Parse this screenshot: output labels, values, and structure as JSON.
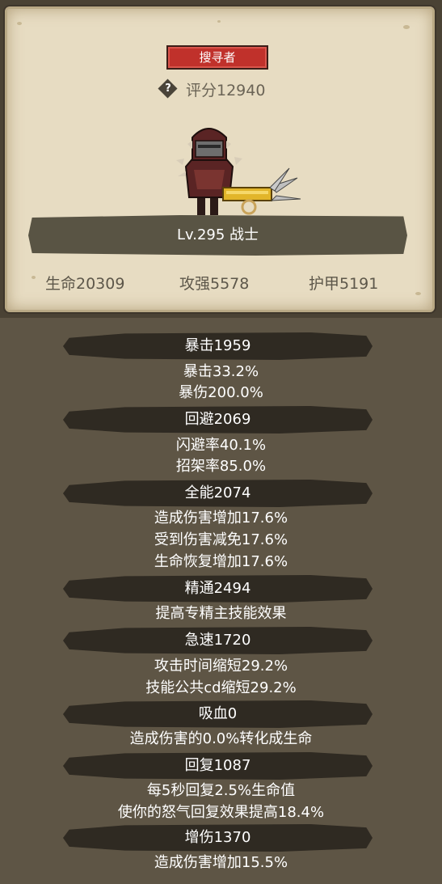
{
  "title_badge": "搜寻者",
  "score": "评分12940",
  "level": "Lv.295 战士",
  "core_stats": {
    "hp": "生命20309",
    "attack": "攻强5578",
    "armor": "护甲5191"
  },
  "stats": {
    "crit": {
      "header": "暴击1959",
      "lines": [
        "暴击33.2%",
        "暴伤200.0%"
      ]
    },
    "dodge": {
      "header": "回避2069",
      "lines": [
        "闪避率40.1%",
        "招架率85.0%"
      ]
    },
    "versatility": {
      "header": "全能2074",
      "lines": [
        "造成伤害增加17.6%",
        "受到伤害减免17.6%",
        "生命恢复增加17.6%"
      ]
    },
    "mastery": {
      "header": "精通2494",
      "lines": [
        "提高专精主技能效果"
      ]
    },
    "haste": {
      "header": "急速1720",
      "lines": [
        "攻击时间缩短29.2%",
        "技能公共cd缩短29.2%"
      ]
    },
    "leech": {
      "header": "吸血0",
      "lines": [
        "造成伤害的0.0%转化成生命"
      ]
    },
    "recovery": {
      "header": "回复1087",
      "lines": [
        "每5秒回复2.5%生命值",
        "使你的怒气回复效果提高18.4%"
      ]
    },
    "damage": {
      "header": "增伤1370",
      "lines": [
        "造成伤害增加15.5%"
      ]
    }
  },
  "colors": {
    "badge_red": "#c0312b",
    "parchment": "#e7dcc2",
    "panel_bg": "#5e5545",
    "header_bar": "#2f2a22"
  }
}
